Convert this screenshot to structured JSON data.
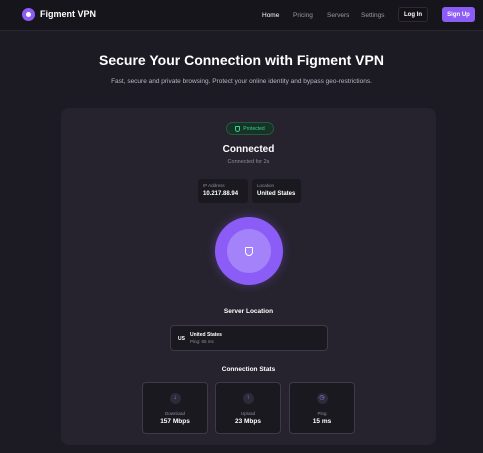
{
  "brand": {
    "name": "Figment VPN"
  },
  "nav": {
    "links": [
      "Home",
      "Pricing",
      "Servers",
      "Settings"
    ],
    "login_label": "Log In",
    "signup_label": "Sign Up"
  },
  "hero": {
    "title": "Secure Your Connection with Figment VPN",
    "subtitle": "Fast, secure and private browsing. Protect your online identity and bypass geo-restrictions."
  },
  "status": {
    "badge": "Protected",
    "title": "Connected",
    "duration": "Connected for 2s",
    "ip_label": "IP Address",
    "ip_value": "10.217.88.94",
    "location_label": "Location",
    "location_value": "United States"
  },
  "server": {
    "section_title": "Server Location",
    "code": "US",
    "name": "United States",
    "ping": "Ping: 65 ms"
  },
  "stats": {
    "section_title": "Connection Stats",
    "download_label": "Download",
    "download_value": "157 Mbps",
    "upload_label": "Upload",
    "upload_value": "23 Mbps",
    "ping_label": "Ping",
    "ping_value": "15 ms"
  },
  "colors": {
    "accent": "#8b5cf6",
    "success": "#34d399",
    "background": "#1c1a22",
    "card": "#26232e"
  },
  "icons": {
    "logo": "shield-logo-icon",
    "badge": "shield-icon",
    "power": "shield-icon",
    "download": "arrow-down-icon",
    "upload": "arrow-up-icon",
    "ping": "clock-icon"
  }
}
